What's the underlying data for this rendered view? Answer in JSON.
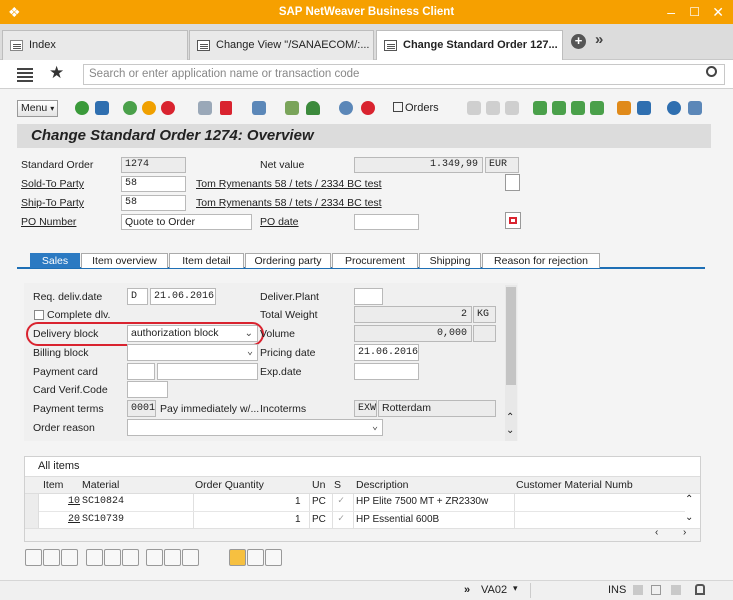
{
  "window": {
    "title": "SAP NetWeaver Business Client"
  },
  "tabs": [
    {
      "label": "Index"
    },
    {
      "label": "Change View \"/SANAECOM/:..."
    },
    {
      "label": "Change Standard Order 127..."
    }
  ],
  "search": {
    "placeholder": "Search or enter application name or transaction code"
  },
  "toolbar": {
    "menu_label": "Menu",
    "orders_label": "Orders"
  },
  "page": {
    "title": "Change Standard Order 1274: Overview"
  },
  "header": {
    "standard_order_label": "Standard Order",
    "standard_order_value": "1274",
    "net_value_label": "Net value",
    "net_value": "1.349,99",
    "currency": "EUR",
    "sold_to_label": "Sold-To Party",
    "sold_to_value": "58",
    "sold_to_desc": "Tom Rymenants 58 / tets / 2334 BC test",
    "ship_to_label": "Ship-To Party",
    "ship_to_value": "58",
    "ship_to_desc": "Tom Rymenants 58 / tets / 2334 BC test",
    "po_number_label": "PO Number",
    "po_number_value": "Quote to Order",
    "po_date_label": "PO date",
    "po_date_value": ""
  },
  "subtabs": [
    {
      "label": "Sales"
    },
    {
      "label": "Item overview"
    },
    {
      "label": "Item detail"
    },
    {
      "label": "Ordering party"
    },
    {
      "label": "Procurement"
    },
    {
      "label": "Shipping"
    },
    {
      "label": "Reason for rejection"
    }
  ],
  "sales": {
    "req_deliv_date_label": "Req. deliv.date",
    "req_deliv_date_unit": "D",
    "req_deliv_date_value": "21.06.2016",
    "deliver_plant_label": "Deliver.Plant",
    "complete_dlv_label": "Complete dlv.",
    "total_weight_label": "Total Weight",
    "total_weight_value": "2",
    "total_weight_unit": "KG",
    "delivery_block_label": "Delivery block",
    "delivery_block_value": "authorization block",
    "volume_label": "Volume",
    "volume_value": "0,000",
    "billing_block_label": "Billing block",
    "pricing_date_label": "Pricing date",
    "pricing_date_value": "21.06.2016",
    "payment_card_label": "Payment card",
    "exp_date_label": "Exp.date",
    "card_verif_label": "Card Verif.Code",
    "payment_terms_label": "Payment terms",
    "payment_terms_code": "0001",
    "payment_terms_desc": "Pay immediately w/...",
    "incoterms_label": "Incoterms",
    "incoterms_code": "EXW",
    "incoterms_place": "Rotterdam",
    "order_reason_label": "Order reason"
  },
  "items": {
    "title": "All items",
    "columns": [
      "Item",
      "Material",
      "Order Quantity",
      "Un",
      "S",
      "Description",
      "Customer Material Numb"
    ],
    "rows": [
      {
        "item": "10",
        "material": "SC10824",
        "qty": "1",
        "un": "PC",
        "desc": "HP Elite 7500 MT + ZR2330w"
      },
      {
        "item": "20",
        "material": "SC10739",
        "qty": "1",
        "un": "PC",
        "desc": "HP Essential 600B"
      }
    ]
  },
  "status": {
    "transaction": "VA02",
    "mode": "INS"
  },
  "colors": {
    "titlebar": "#f6a000",
    "accent": "#2c7ac2",
    "highlight": "#d9232f"
  }
}
